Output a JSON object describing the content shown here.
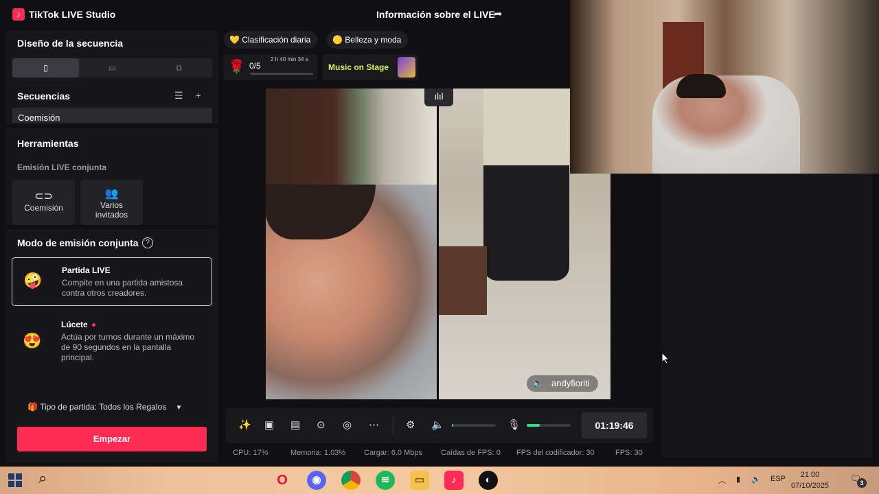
{
  "app": {
    "title": "TikTok LIVE Studio",
    "logo": "tiktok-logo"
  },
  "header": {
    "live_info": "Información sobre el LIVE",
    "share_icon": "share-icon"
  },
  "sidebar": {
    "layout_title": "Diseño de la secuencia",
    "layout_segments": [
      "▯",
      "▭",
      "⧉"
    ],
    "sequences_title": "Secuencias",
    "sequence_item": "Coemisión",
    "tools_title": "Herramientas",
    "joint_live_label": "Emisión LIVE conjunta",
    "tools": [
      {
        "label": "Coemisión",
        "icon": "link-icon"
      },
      {
        "label": "Varios invitados",
        "icon": "people-icon"
      }
    ],
    "mode_title": "Modo de emisión conjunta",
    "modes": [
      {
        "name": "Partida LIVE",
        "desc": "Compite en una partida amistosa contra otros creadores."
      },
      {
        "name": "Lúcete",
        "desc": "Actúa por turnos durante un máximo de 90 segundos en la pantalla principal."
      }
    ],
    "match_type": "Tipo de partida: Todos los Regalos",
    "start_button": "Empezar"
  },
  "chips": {
    "ranking": "Clasificación diaria",
    "category": "Belleza y moda",
    "rose_count": "0/5",
    "rose_time": "2 h 40 min 34 s",
    "stage": "Music on Stage"
  },
  "video": {
    "guest_name": "andyfioriti"
  },
  "controls": {
    "timer": "01:19:46",
    "volume_level": 0.03,
    "mic_level": 0.3
  },
  "stats": {
    "cpu": "CPU:  17%",
    "memory": "Memoria:  1.03%",
    "upload": "Cargar:  6.0 Mbps",
    "fps_drops": "Caídas de FPS:  0",
    "encoder_fps": "FPS del codificador:  30",
    "fps": "FPS:  30"
  },
  "taskbar": {
    "lang": "ESP",
    "time": "21:00",
    "date": "07/10/2025",
    "notifications": "3"
  },
  "colors": {
    "accent": "#fe2c55",
    "level": "#2ee08b",
    "stage": "#d9f05a"
  }
}
